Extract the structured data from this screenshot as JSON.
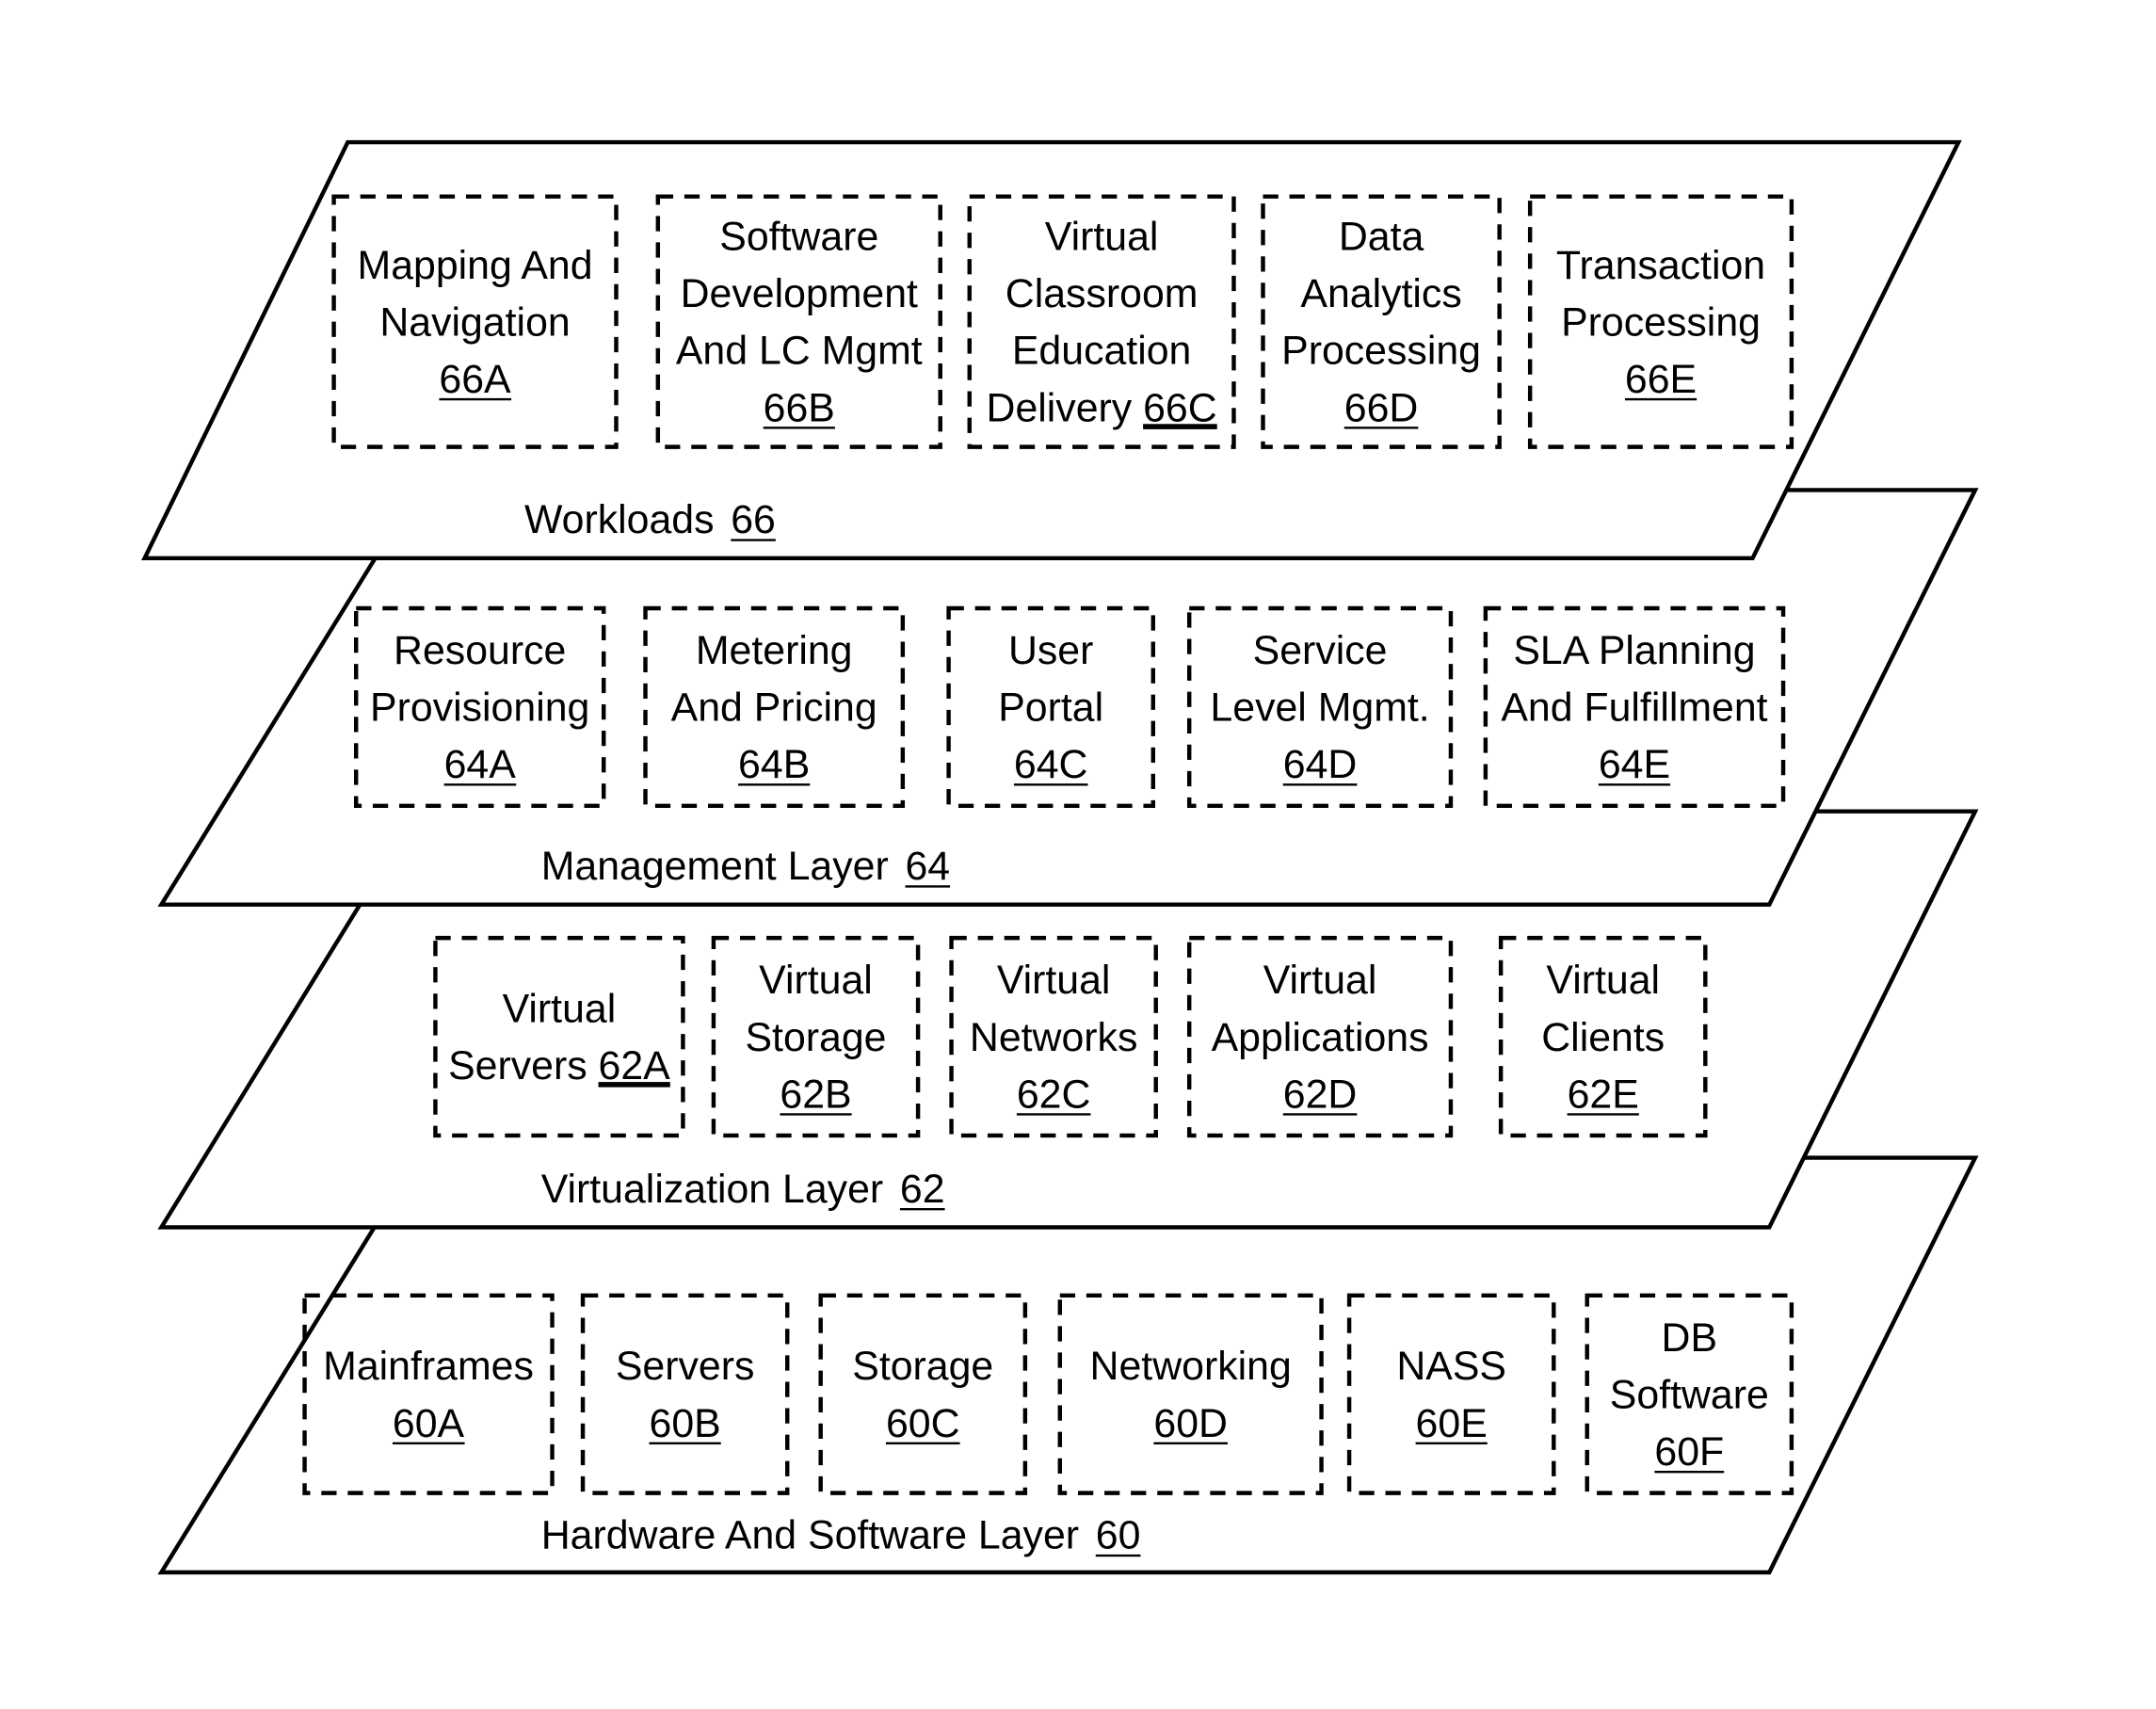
{
  "layers": [
    {
      "name": "Workloads",
      "ref": "66",
      "components": [
        {
          "lines": [
            "Mapping And",
            "Navigation"
          ],
          "ref": "66A"
        },
        {
          "lines": [
            "Software",
            "Development",
            "And LC Mgmt"
          ],
          "ref": "66B"
        },
        {
          "lines": [
            "Virtual",
            "Classroom",
            "Education",
            "Delivery"
          ],
          "ref": "66C",
          "ref_inline": true
        },
        {
          "lines": [
            "Data",
            "Analytics",
            "Processing"
          ],
          "ref": "66D"
        },
        {
          "lines": [
            "Transaction",
            "Processing"
          ],
          "ref": "66E"
        }
      ]
    },
    {
      "name": "Management Layer",
      "ref": "64",
      "components": [
        {
          "lines": [
            "Resource",
            "Provisioning"
          ],
          "ref": "64A"
        },
        {
          "lines": [
            "Metering",
            "And Pricing"
          ],
          "ref": "64B"
        },
        {
          "lines": [
            "User",
            "Portal"
          ],
          "ref": "64C"
        },
        {
          "lines": [
            "Service",
            "Level Mgmt."
          ],
          "ref": "64D"
        },
        {
          "lines": [
            "SLA Planning",
            "And Fulfillment"
          ],
          "ref": "64E"
        }
      ]
    },
    {
      "name": "Virtualization Layer",
      "ref": "62",
      "components": [
        {
          "lines": [
            "Virtual",
            "Servers"
          ],
          "ref": "62A",
          "ref_inline": true
        },
        {
          "lines": [
            "Virtual",
            "Storage"
          ],
          "ref": "62B"
        },
        {
          "lines": [
            "Virtual",
            "Networks"
          ],
          "ref": "62C"
        },
        {
          "lines": [
            "Virtual",
            "Applications"
          ],
          "ref": "62D"
        },
        {
          "lines": [
            "Virtual",
            "Clients"
          ],
          "ref": "62E"
        }
      ]
    },
    {
      "name": "Hardware And Software Layer",
      "ref": "60",
      "components": [
        {
          "lines": [
            "Mainframes"
          ],
          "ref": "60A"
        },
        {
          "lines": [
            "Servers"
          ],
          "ref": "60B"
        },
        {
          "lines": [
            "Storage"
          ],
          "ref": "60C"
        },
        {
          "lines": [
            "Networking"
          ],
          "ref": "60D"
        },
        {
          "lines": [
            "NASS"
          ],
          "ref": "60E"
        },
        {
          "lines": [
            "DB",
            "Software"
          ],
          "ref": "60F"
        }
      ]
    }
  ]
}
